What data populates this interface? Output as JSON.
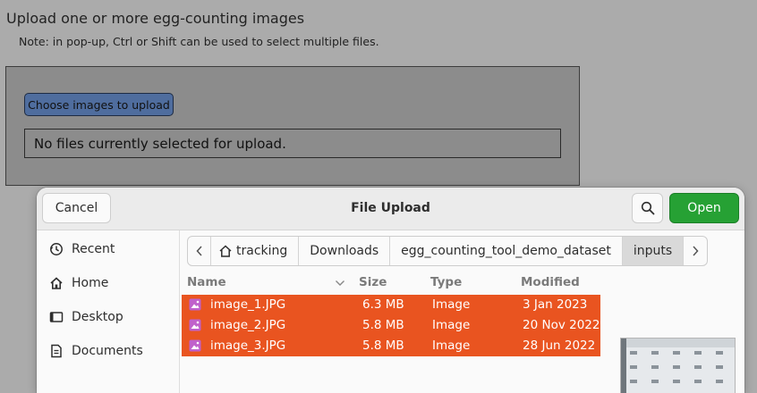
{
  "page": {
    "title": "Upload one or more egg-counting images",
    "note": "Note: in pop-up, Ctrl or Shift can be used to select multiple files."
  },
  "upload": {
    "choose_label": "Choose images to upload",
    "status": "No files currently selected for upload."
  },
  "dialog": {
    "title": "File Upload",
    "cancel_label": "Cancel",
    "open_label": "Open",
    "sidebar": [
      {
        "label": "Recent",
        "icon": "clock-icon"
      },
      {
        "label": "Home",
        "icon": "home-icon"
      },
      {
        "label": "Desktop",
        "icon": "desktop-icon"
      },
      {
        "label": "Documents",
        "icon": "document-icon"
      }
    ],
    "path": [
      "tracking",
      "Downloads",
      "egg_counting_tool_demo_dataset",
      "inputs"
    ],
    "columns": {
      "name": "Name",
      "size": "Size",
      "type": "Type",
      "modified": "Modified"
    },
    "files": [
      {
        "name": "image_1.JPG",
        "size": "6.3 MB",
        "type": "Image",
        "modified": "3 Jan 2023"
      },
      {
        "name": "image_2.JPG",
        "size": "5.8 MB",
        "type": "Image",
        "modified": "20 Nov 2022"
      },
      {
        "name": "image_3.JPG",
        "size": "5.8 MB",
        "type": "Image",
        "modified": "28 Jun 2022"
      }
    ]
  },
  "colors": {
    "selection": "#e95420",
    "open_button": "#26a134",
    "choose_button": "#4f6d9e"
  }
}
